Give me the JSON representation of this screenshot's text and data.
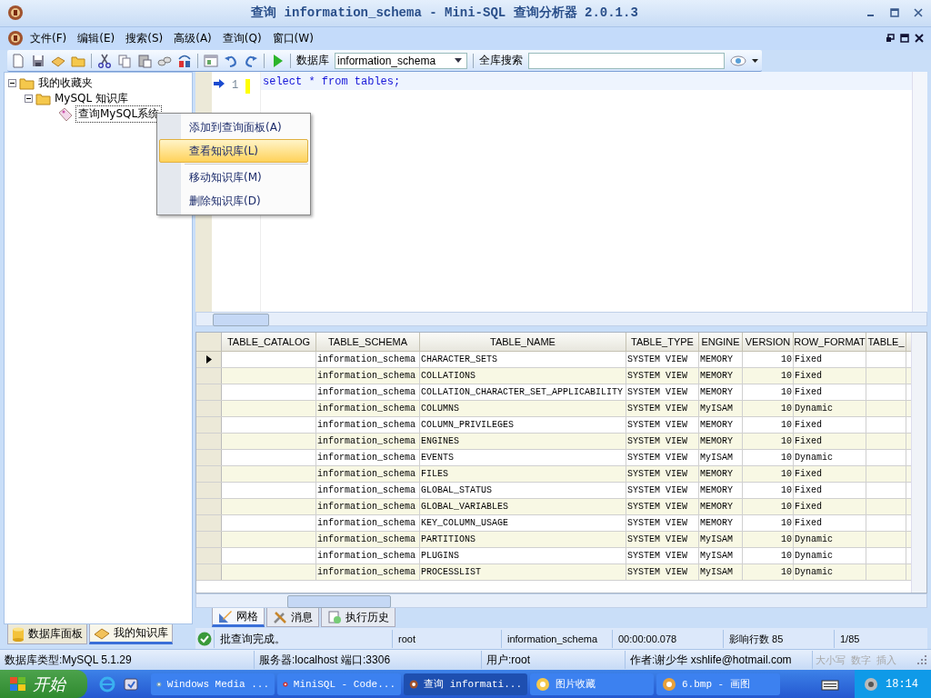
{
  "window": {
    "title": "查询 information_schema - Mini-SQL 查询分析器 2.0.1.3"
  },
  "menu": [
    "文件(F)",
    "编辑(E)",
    "搜索(S)",
    "高级(A)",
    "查询(Q)",
    "窗口(W)"
  ],
  "toolbar": {
    "database_label": "数据库",
    "database_value": "information_schema",
    "search_label": "全库搜索"
  },
  "tree": [
    {
      "label": "我的收藏夹",
      "expanded": true,
      "children": [
        {
          "label": "MySQL 知识库",
          "expanded": true,
          "children": [
            {
              "label": "查询MySQL系统",
              "selected": true
            }
          ]
        }
      ]
    }
  ],
  "context_menu": [
    {
      "kind": "item",
      "label": "添加到查询面板(A)",
      "selected": false
    },
    {
      "kind": "item",
      "label": "查看知识库(L)",
      "selected": true
    },
    {
      "kind": "separator"
    },
    {
      "kind": "item",
      "label": "移动知识库(M)",
      "selected": false
    },
    {
      "kind": "item",
      "label": "删除知识库(D)",
      "selected": false
    }
  ],
  "left_tabs": [
    {
      "label": "数据库面板",
      "selected": false
    },
    {
      "label": "我的知识库",
      "selected": true
    }
  ],
  "editor": {
    "line_number": "1",
    "code": "select * from tables;"
  },
  "table": {
    "columns": [
      "TABLE_CATALOG",
      "TABLE_SCHEMA",
      "TABLE_NAME",
      "TABLE_TYPE",
      "ENGINE",
      "VERSION",
      "ROW_FORMAT",
      "TABLE_"
    ],
    "rows": [
      {
        "selected": true,
        "cells": [
          "",
          "information_schema",
          "CHARACTER_SETS",
          "SYSTEM VIEW",
          "MEMORY",
          "10",
          "Fixed",
          ""
        ]
      },
      {
        "selected": false,
        "cells": [
          "",
          "information_schema",
          "COLLATIONS",
          "SYSTEM VIEW",
          "MEMORY",
          "10",
          "Fixed",
          ""
        ]
      },
      {
        "selected": false,
        "cells": [
          "",
          "information_schema",
          "COLLATION_CHARACTER_SET_APPLICABILITY",
          "SYSTEM VIEW",
          "MEMORY",
          "10",
          "Fixed",
          ""
        ]
      },
      {
        "selected": false,
        "cells": [
          "",
          "information_schema",
          "COLUMNS",
          "SYSTEM VIEW",
          "MyISAM",
          "10",
          "Dynamic",
          ""
        ]
      },
      {
        "selected": false,
        "cells": [
          "",
          "information_schema",
          "COLUMN_PRIVILEGES",
          "SYSTEM VIEW",
          "MEMORY",
          "10",
          "Fixed",
          ""
        ]
      },
      {
        "selected": false,
        "cells": [
          "",
          "information_schema",
          "ENGINES",
          "SYSTEM VIEW",
          "MEMORY",
          "10",
          "Fixed",
          ""
        ]
      },
      {
        "selected": false,
        "cells": [
          "",
          "information_schema",
          "EVENTS",
          "SYSTEM VIEW",
          "MyISAM",
          "10",
          "Dynamic",
          ""
        ]
      },
      {
        "selected": false,
        "cells": [
          "",
          "information_schema",
          "FILES",
          "SYSTEM VIEW",
          "MEMORY",
          "10",
          "Fixed",
          ""
        ]
      },
      {
        "selected": false,
        "cells": [
          "",
          "information_schema",
          "GLOBAL_STATUS",
          "SYSTEM VIEW",
          "MEMORY",
          "10",
          "Fixed",
          ""
        ]
      },
      {
        "selected": false,
        "cells": [
          "",
          "information_schema",
          "GLOBAL_VARIABLES",
          "SYSTEM VIEW",
          "MEMORY",
          "10",
          "Fixed",
          ""
        ]
      },
      {
        "selected": false,
        "cells": [
          "",
          "information_schema",
          "KEY_COLUMN_USAGE",
          "SYSTEM VIEW",
          "MEMORY",
          "10",
          "Fixed",
          ""
        ]
      },
      {
        "selected": false,
        "cells": [
          "",
          "information_schema",
          "PARTITIONS",
          "SYSTEM VIEW",
          "MyISAM",
          "10",
          "Dynamic",
          ""
        ]
      },
      {
        "selected": false,
        "cells": [
          "",
          "information_schema",
          "PLUGINS",
          "SYSTEM VIEW",
          "MyISAM",
          "10",
          "Dynamic",
          ""
        ]
      },
      {
        "selected": false,
        "cells": [
          "",
          "information_schema",
          "PROCESSLIST",
          "SYSTEM VIEW",
          "MyISAM",
          "10",
          "Dynamic",
          ""
        ]
      }
    ]
  },
  "result_tabs": [
    {
      "label": "网格",
      "selected": true
    },
    {
      "label": "消息",
      "selected": false
    },
    {
      "label": "执行历史",
      "selected": false
    }
  ],
  "query_status": [
    "批查询完成。",
    "root",
    "information_schema",
    "00:00:00.078",
    "影响行数 85",
    "1/85"
  ],
  "status_bar": {
    "fields": [
      "数据库类型:MySQL 5.1.29",
      "服务器:localhost  端口:3306",
      "用户:root",
      "作者:谢少华  xshlife@hotmail.com"
    ],
    "indicators": [
      {
        "label": "大小写",
        "on": false
      },
      {
        "label": "数字",
        "on": false
      },
      {
        "label": "插入",
        "on": false
      }
    ]
  },
  "taskbar": {
    "start": "开始",
    "tasks": [
      {
        "label": "Windows Media ...",
        "selected": false
      },
      {
        "label": "MiniSQL - Code...",
        "selected": false
      },
      {
        "label": "查询 informati...",
        "selected": true
      },
      {
        "label": "图片收藏",
        "selected": false
      },
      {
        "label": "6.bmp - 画图",
        "selected": false
      }
    ],
    "clock": "18:14"
  }
}
